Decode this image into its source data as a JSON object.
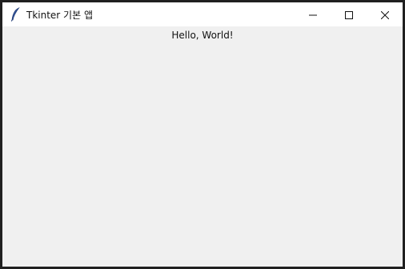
{
  "window": {
    "title": "Tkinter 기본 앱",
    "icon": "feather-icon",
    "controls": [
      "minimize-icon",
      "maximize-icon",
      "close-icon"
    ]
  },
  "content": {
    "label": "Hello, World!"
  },
  "colors": {
    "titlebar_bg": "#ffffff",
    "client_bg": "#f0f0f0",
    "border": "#202020",
    "text": "#111111"
  }
}
